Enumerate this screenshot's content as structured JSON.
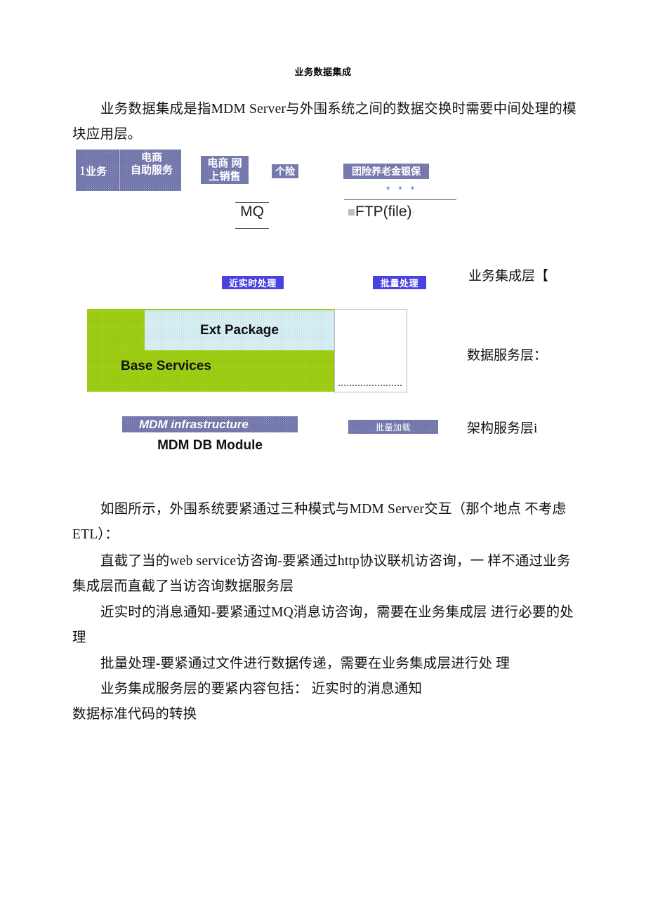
{
  "document": {
    "title": "业务数据集成",
    "intro": "业务数据集成是指MDM Server与外围系统之间的数据交换时需要中间处理的模块应用层。",
    "paragraphs": [
      "如图所示，外围系统要紧通过三种模式与MDM Server交互（那个地点 不考虑 ETL）：",
      "直截了当的web service访咨询-要紧通过http协议联机访咨询，一 样不通过业务集成层而直截了当访咨询数据服务层",
      "近实时的消息通知-要紧通过MQ消息访咨询，需要在业务集成层 进行必要的处理",
      "批量处理-要紧通过文件进行数据传递，需要在业务集成层进行处 理",
      "业务集成服务层的要紧内容包括： 近实时的消息通知",
      "数据标准代码的转换"
    ]
  },
  "diagram": {
    "source_systems": [
      {
        "id": "ecom-selfservice",
        "line_a_number": "1",
        "line_a_text": "业务",
        "line_b_text": "电商\n自助服务"
      },
      {
        "id": "online-sales",
        "label": "电商 网\n上销售"
      },
      {
        "id": "personal-ins",
        "label": "个险"
      },
      {
        "id": "group-ins",
        "label": "团险养老金银保"
      }
    ],
    "channels": {
      "mq": "MQ",
      "asterisks": "* * *",
      "ftp": "FTP(file)",
      "ftp_tail": "·"
    },
    "process_labels": {
      "near_realtime": "近实时处理",
      "batch_process": "批量处理",
      "batch_load": "批量加载"
    },
    "services": {
      "ext_package": "Ext Package",
      "base_services": "Base Services"
    },
    "infrastructure": {
      "mdm_infrastructure": "MDM infrastructure",
      "mdm_db_module": "MDM DB Module"
    },
    "layer_labels": {
      "business_integration": "业务集成层【",
      "data_service": "数据服务层：",
      "architecture_service": "架构服务层i"
    },
    "colors": {
      "purple_box": "#6e72a8",
      "blue_highlight": "#4a42e0",
      "green_fill": "#9ccc10",
      "light_blue": "#d4edf1",
      "asterisk_blue": "#4a62c8"
    }
  }
}
